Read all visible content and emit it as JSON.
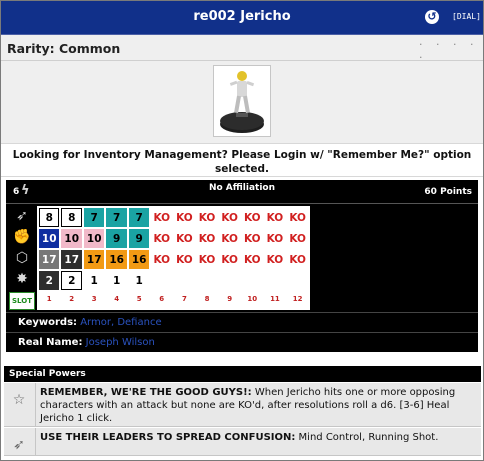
{
  "header": {
    "title": "re002 Jericho",
    "dial_label": "[DIAL]"
  },
  "rarity": {
    "label": "Rarity: Common",
    "dots": "· · · · ·"
  },
  "login_message": {
    "line1": "Looking for Inventory Management? Please Login w/ \"Remember Me?\" option",
    "line2": "selected."
  },
  "dial": {
    "range": "6",
    "affiliation": "No Affiliation",
    "points": "60 Points",
    "rows": [
      [
        {
          "v": "8",
          "c": "c-white"
        },
        {
          "v": "8",
          "c": "c-white"
        },
        {
          "v": "7",
          "c": "c-teal"
        },
        {
          "v": "7",
          "c": "c-teal"
        },
        {
          "v": "7",
          "c": "c-teal"
        },
        {
          "v": "KO",
          "c": "c-ko"
        },
        {
          "v": "KO",
          "c": "c-ko"
        },
        {
          "v": "KO",
          "c": "c-ko"
        },
        {
          "v": "KO",
          "c": "c-ko"
        },
        {
          "v": "KO",
          "c": "c-ko"
        },
        {
          "v": "KO",
          "c": "c-ko"
        },
        {
          "v": "KO",
          "c": "c-ko"
        }
      ],
      [
        {
          "v": "10",
          "c": "c-blue"
        },
        {
          "v": "10",
          "c": "c-pink"
        },
        {
          "v": "10",
          "c": "c-pink"
        },
        {
          "v": "9",
          "c": "c-teal"
        },
        {
          "v": "9",
          "c": "c-teal"
        },
        {
          "v": "KO",
          "c": "c-ko"
        },
        {
          "v": "KO",
          "c": "c-ko"
        },
        {
          "v": "KO",
          "c": "c-ko"
        },
        {
          "v": "KO",
          "c": "c-ko"
        },
        {
          "v": "KO",
          "c": "c-ko"
        },
        {
          "v": "KO",
          "c": "c-ko"
        },
        {
          "v": "KO",
          "c": "c-ko"
        }
      ],
      [
        {
          "v": "17",
          "c": "c-gray"
        },
        {
          "v": "17",
          "c": "c-dark"
        },
        {
          "v": "17",
          "c": "c-orange"
        },
        {
          "v": "16",
          "c": "c-orange"
        },
        {
          "v": "16",
          "c": "c-orange"
        },
        {
          "v": "KO",
          "c": "c-ko"
        },
        {
          "v": "KO",
          "c": "c-ko"
        },
        {
          "v": "KO",
          "c": "c-ko"
        },
        {
          "v": "KO",
          "c": "c-ko"
        },
        {
          "v": "KO",
          "c": "c-ko"
        },
        {
          "v": "KO",
          "c": "c-ko"
        },
        {
          "v": "KO",
          "c": "c-ko"
        }
      ],
      [
        {
          "v": "2",
          "c": "c-dark"
        },
        {
          "v": "2",
          "c": "c-white"
        },
        {
          "v": "1",
          "c": "c-plain"
        },
        {
          "v": "1",
          "c": "c-plain"
        },
        {
          "v": "1",
          "c": "c-plain"
        },
        {
          "v": "",
          "c": "c-empty"
        },
        {
          "v": "",
          "c": "c-empty"
        },
        {
          "v": "",
          "c": "c-empty"
        },
        {
          "v": "",
          "c": "c-empty"
        },
        {
          "v": "",
          "c": "c-empty"
        },
        {
          "v": "",
          "c": "c-empty"
        },
        {
          "v": "",
          "c": "c-empty"
        }
      ]
    ],
    "clicks": [
      "1",
      "2",
      "3",
      "4",
      "5",
      "6",
      "7",
      "8",
      "9",
      "10",
      "11",
      "12"
    ],
    "slot_label": "SLOT",
    "stat_icons": [
      "speed-wing-icon",
      "attack-fist-icon",
      "defense-shield-icon",
      "damage-starburst-icon"
    ],
    "keywords_label": "Keywords:",
    "keywords": [
      "Armor",
      "Defiance"
    ],
    "real_name_label": "Real Name:",
    "real_name": "Joseph Wilson"
  },
  "special_powers": {
    "header": "Special Powers",
    "items": [
      {
        "icon": "star-icon",
        "name": "REMEMBER, WE'RE THE GOOD GUYS!:",
        "text": "When Jericho hits one or more opposing characters with an attack but none are KO'd, after resolutions roll a d6. [3-6] Heal Jericho 1 click."
      },
      {
        "icon": "wing-icon",
        "name": "USE THEIR LEADERS TO SPREAD CONFUSION:",
        "text": "Mind Control, Running Shot."
      }
    ]
  },
  "colors": {
    "title_bar": "#11308a",
    "ko_text": "#d12020",
    "slot_green": "#1a8a1a",
    "keyword_link": "#2a52be"
  }
}
